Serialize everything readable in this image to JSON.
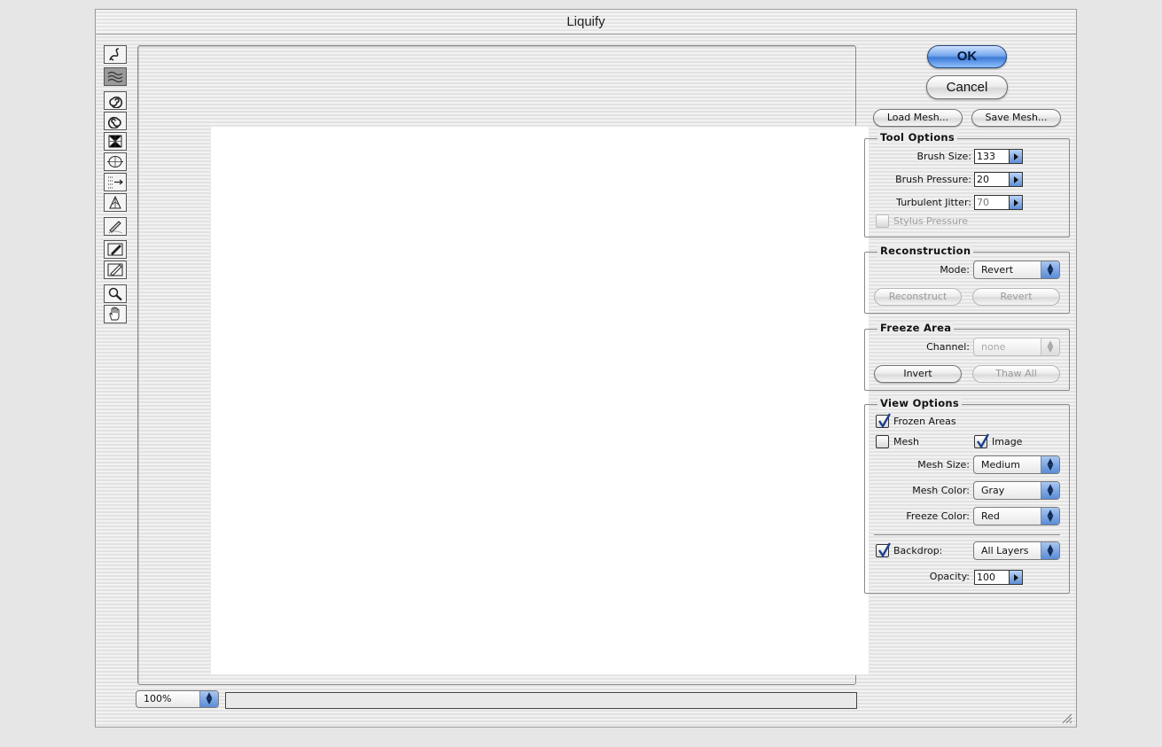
{
  "window": {
    "title": "Liquify"
  },
  "tools": [
    {
      "name": "warp-tool-icon",
      "selected": false
    },
    {
      "name": "turbulence-tool-icon",
      "selected": true
    },
    {
      "name": "twirl-clockwise-tool-icon",
      "selected": false
    },
    {
      "name": "twirl-counterclockwise-tool-icon",
      "selected": false
    },
    {
      "name": "pucker-tool-icon",
      "selected": false
    },
    {
      "name": "bloat-tool-icon",
      "selected": false
    },
    {
      "name": "shift-pixels-tool-icon",
      "selected": false
    },
    {
      "name": "reflection-tool-icon",
      "selected": false
    },
    {
      "name": "reconstruct-tool-icon",
      "selected": false
    },
    {
      "name": "freeze-tool-icon",
      "selected": false
    },
    {
      "name": "thaw-tool-icon",
      "selected": false
    },
    {
      "name": "zoom-tool-icon",
      "selected": false
    },
    {
      "name": "hand-tool-icon",
      "selected": false
    }
  ],
  "buttons": {
    "ok": "OK",
    "cancel": "Cancel",
    "load_mesh": "Load Mesh...",
    "save_mesh": "Save Mesh..."
  },
  "tool_options": {
    "title": "Tool Options",
    "brush_size_label": "Brush Size:",
    "brush_size": "133",
    "brush_pressure_label": "Brush Pressure:",
    "brush_pressure": "20",
    "turbulent_jitter_label": "Turbulent Jitter:",
    "turbulent_jitter": "70",
    "stylus_pressure_label": "Stylus Pressure",
    "stylus_pressure_checked": false
  },
  "reconstruction": {
    "title": "Reconstruction",
    "mode_label": "Mode:",
    "mode_value": "Revert",
    "reconstruct_button": "Reconstruct",
    "revert_button": "Revert"
  },
  "freeze_area": {
    "title": "Freeze Area",
    "channel_label": "Channel:",
    "channel_value": "none",
    "invert_button": "Invert",
    "thaw_all_button": "Thaw All"
  },
  "view_options": {
    "title": "View Options",
    "frozen_areas_label": "Frozen Areas",
    "frozen_areas_checked": true,
    "mesh_label": "Mesh",
    "mesh_checked": false,
    "image_label": "Image",
    "image_checked": true,
    "mesh_size_label": "Mesh Size:",
    "mesh_size_value": "Medium",
    "mesh_color_label": "Mesh Color:",
    "mesh_color_value": "Gray",
    "freeze_color_label": "Freeze Color:",
    "freeze_color_value": "Red",
    "backdrop_label": "Backdrop:",
    "backdrop_checked": true,
    "backdrop_value": "All Layers",
    "opacity_label": "Opacity:",
    "opacity_value": "100"
  },
  "footer": {
    "zoom": "100%"
  },
  "colors": {
    "aqua_blue": "#5a8cd6",
    "canvas": "#ffffff"
  }
}
